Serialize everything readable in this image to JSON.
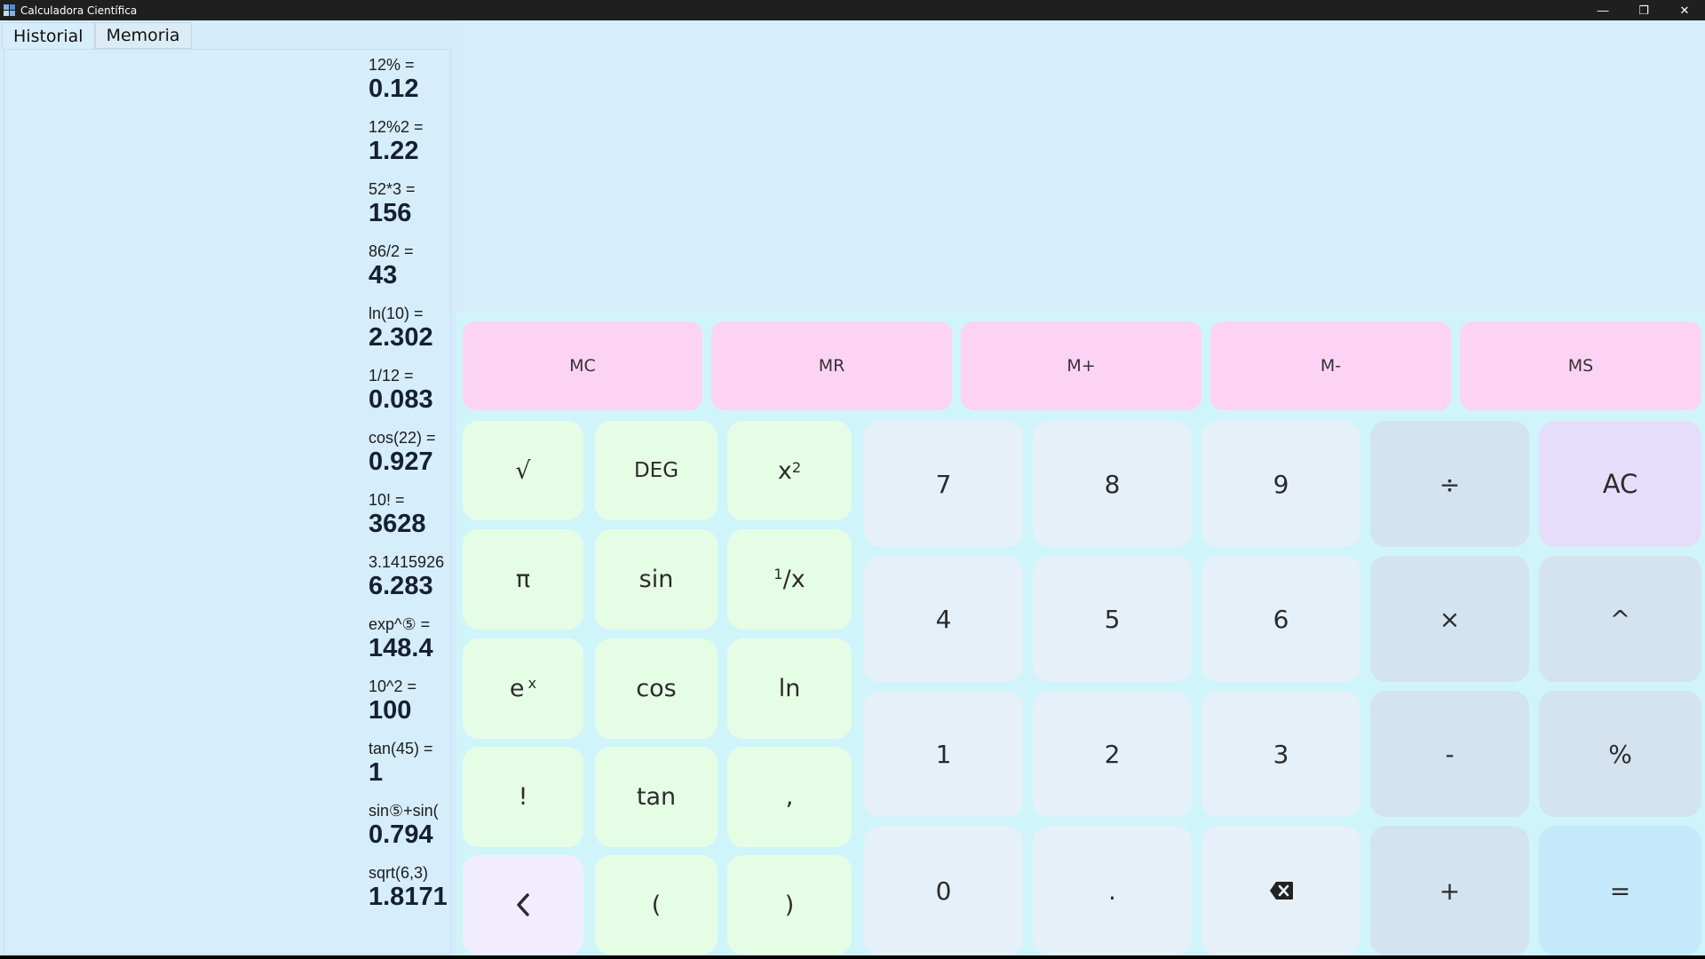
{
  "window": {
    "title": "Calculadora Científica",
    "minimize": "—",
    "restore": "❐",
    "close": "✕"
  },
  "sidebar": {
    "tabs": [
      "Historial",
      "Memoria"
    ],
    "history": [
      {
        "expr": "12% =",
        "result": "0.12"
      },
      {
        "expr": "12%2 =",
        "result": "1.22"
      },
      {
        "expr": "52*3 =",
        "result": "156"
      },
      {
        "expr": "86/2 =",
        "result": "43"
      },
      {
        "expr": "ln(10) =",
        "result": "2.302"
      },
      {
        "expr": "1/12 =",
        "result": "0.083"
      },
      {
        "expr": "cos(22) =",
        "result": "0.927"
      },
      {
        "expr": "10! =",
        "result": "3628"
      },
      {
        "expr": "3.1415926",
        "result": "6.283"
      },
      {
        "expr": "exp^⑤ =",
        "result": "148.4"
      },
      {
        "expr": "10^2 =",
        "result": "100"
      },
      {
        "expr": "tan(45) =",
        "result": "1"
      },
      {
        "expr": "sin⑤+sin(",
        "result": "0.794"
      },
      {
        "expr": "sqrt(6,3)",
        "result": "1.8171"
      }
    ]
  },
  "memory_keys": [
    "MC",
    "MR",
    "M+",
    "M-",
    "MS"
  ],
  "sci_keys": {
    "sqrt": "√",
    "deg": "DEG",
    "square_base": "x",
    "square_exp": "2",
    "pi": "π",
    "sin": "sin",
    "recip_num": "1",
    "recip_rest": "/x",
    "exp_base": "e",
    "exp_exp": "x",
    "cos": "cos",
    "ln": "ln",
    "fact": "!",
    "tan": "tan",
    "comma": ",",
    "back": "‹",
    "lparen": "(",
    "rparen": ")"
  },
  "num_keys": {
    "k7": "7",
    "k8": "8",
    "k9": "9",
    "k4": "4",
    "k5": "5",
    "k6": "6",
    "k1": "1",
    "k2": "2",
    "k3": "3",
    "k0": "0",
    "dot": "."
  },
  "op_keys": {
    "div": "÷",
    "mul": "×",
    "minus": "-",
    "plus": "+",
    "pow": "^",
    "pct": "%",
    "ac": "AC",
    "eq": "="
  }
}
